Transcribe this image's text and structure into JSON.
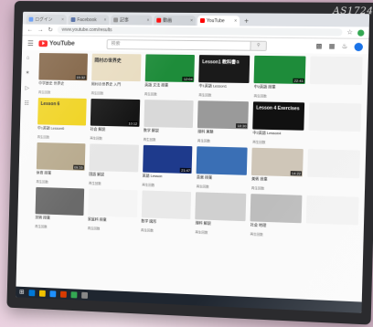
{
  "monitor": {
    "brand": "AS1724"
  },
  "browser": {
    "tabs": [
      {
        "label": "ログイン",
        "color": "#4285f4"
      },
      {
        "label": "Facebook",
        "color": "#3b5998"
      },
      {
        "label": "記事",
        "color": "#888888"
      },
      {
        "label": "動画",
        "color": "#ff0000"
      },
      {
        "label": "YouTube",
        "color": "#ff0000",
        "active": true
      }
    ],
    "url": "www.youtube.com/results"
  },
  "youtube": {
    "logo_text": "YouTube",
    "search_placeholder": "検索"
  },
  "videos": [
    {
      "thumb_color": "#7a5a3a",
      "label": "",
      "duration": "15:32",
      "title": "中学歴史 世界史",
      "meta": "再生回数"
    },
    {
      "thumb_color": "#e8dcc0",
      "label": "岡村の世界史",
      "duration": "",
      "title": "岡村の世界史 入門",
      "meta": "再生回数"
    },
    {
      "thumb_color": "#1e8c3a",
      "label": "",
      "duration": "12:04",
      "title": "英語 文法 授業",
      "meta": "再生回数"
    },
    {
      "thumb_color": "#1a1a1a",
      "label": "Lesson1 教科書①",
      "duration": "",
      "title": "中1英語 Lesson1",
      "meta": "再生回数"
    },
    {
      "thumb_color": "#1e8c3a",
      "label": "",
      "duration": "22:41",
      "title": "中2英語 授業",
      "meta": "再生回数"
    },
    {
      "thumb_color": "#f2f2f2",
      "label": "",
      "duration": "",
      "title": "",
      "meta": ""
    },
    {
      "thumb_color": "#f0d21a",
      "label": "Lesson 6",
      "duration": "",
      "title": "中1英語 Lesson6",
      "meta": "再生回数"
    },
    {
      "thumb_color": "#151515",
      "label": "",
      "duration": "10:12",
      "title": "社会 解説",
      "meta": "再生回数"
    },
    {
      "thumb_color": "#d9d9d9",
      "label": "",
      "duration": "",
      "title": "数学 解説",
      "meta": "再生回数"
    },
    {
      "thumb_color": "#9a9a9a",
      "label": "",
      "duration": "18:30",
      "title": "理科 実験",
      "meta": "再生回数"
    },
    {
      "thumb_color": "#111111",
      "label": "Lesson 4 Exercises",
      "duration": "",
      "title": "中2英語 Lesson4",
      "meta": "再生回数"
    },
    {
      "thumb_color": "#f2f2f2",
      "label": "",
      "duration": "",
      "title": "",
      "meta": ""
    },
    {
      "thumb_color": "#b7a98c",
      "label": "",
      "duration": "09:55",
      "title": "体育 授業",
      "meta": "再生回数"
    },
    {
      "thumb_color": "#e6e6e6",
      "label": "",
      "duration": "",
      "title": "国語 解説",
      "meta": "再生回数"
    },
    {
      "thumb_color": "#1e3a8c",
      "label": "",
      "duration": "21:47",
      "title": "英語 Lesson",
      "meta": "再生回数"
    },
    {
      "thumb_color": "#3a6fb5",
      "label": "",
      "duration": "",
      "title": "音楽 授業",
      "meta": "再生回数"
    },
    {
      "thumb_color": "#cfc6b8",
      "label": "",
      "duration": "14:22",
      "title": "美術 授業",
      "meta": "再生回数"
    },
    {
      "thumb_color": "#f2f2f2",
      "label": "",
      "duration": "",
      "title": "",
      "meta": ""
    },
    {
      "thumb_color": "#6a6a6a",
      "label": "",
      "duration": "",
      "title": "技術 授業",
      "meta": "再生回数"
    },
    {
      "thumb_color": "#f5f5f5",
      "label": "",
      "duration": "",
      "title": "家庭科 授業",
      "meta": "再生回数"
    },
    {
      "thumb_color": "#e9e9e9",
      "label": "",
      "duration": "",
      "title": "数学 図形",
      "meta": "再生回数"
    },
    {
      "thumb_color": "#d0d0d0",
      "label": "",
      "duration": "",
      "title": "理科 解説",
      "meta": "再生回数"
    },
    {
      "thumb_color": "#bdbdbd",
      "label": "",
      "duration": "",
      "title": "社会 地理",
      "meta": "再生回数"
    },
    {
      "thumb_color": "#f2f2f2",
      "label": "",
      "duration": "",
      "title": "",
      "meta": ""
    }
  ],
  "taskbar_icons": [
    "#0078d7",
    "#f2c200",
    "#1e90ff",
    "#d83b01",
    "#34a853",
    "#888888"
  ]
}
